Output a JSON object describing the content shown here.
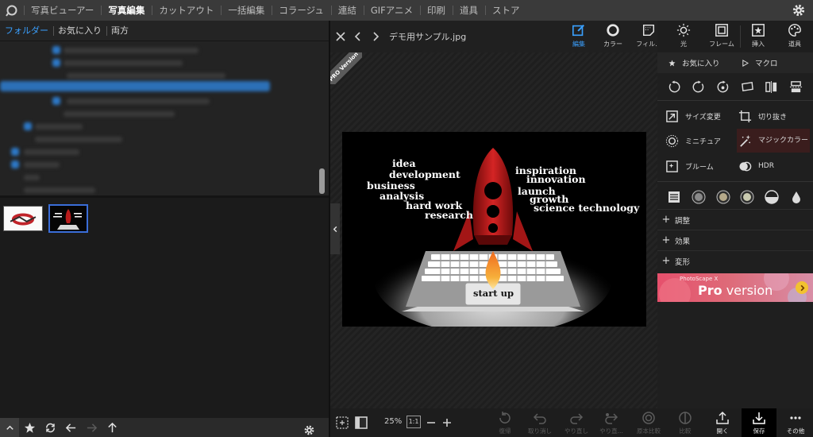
{
  "menu": {
    "items": [
      {
        "label": "写真ビューアー",
        "active": false
      },
      {
        "label": "写真編集",
        "active": true
      },
      {
        "label": "カットアウト",
        "active": false
      },
      {
        "label": "一括編集",
        "active": false
      },
      {
        "label": "コラージュ",
        "active": false
      },
      {
        "label": "連結",
        "active": false
      },
      {
        "label": "GIFアニメ",
        "active": false
      },
      {
        "label": "印刷",
        "active": false
      },
      {
        "label": "道具",
        "active": false
      },
      {
        "label": "ストア",
        "active": false
      }
    ]
  },
  "left_panel": {
    "tabs": [
      {
        "label": "フォルダー",
        "active": true
      },
      {
        "label": "お気に入り",
        "active": false
      },
      {
        "label": "両方",
        "active": false
      }
    ],
    "thumbnails": [
      "thumb-1",
      "thumb-2"
    ],
    "selected_thumbnail": 2
  },
  "editor": {
    "file_name": "デモ用サンプル.jpg",
    "ribbon": "PRO Version"
  },
  "photo_words": [
    "idea",
    "development",
    "business",
    "analysis",
    "hard work",
    "research",
    "inspiration",
    "innovation",
    "launch",
    "growth",
    "science technology"
  ],
  "photo_key_label": "start up",
  "tool_tabs": [
    {
      "label": "編集",
      "icon": "edit-icon",
      "active": true
    },
    {
      "label": "カラー",
      "icon": "color-ring-icon",
      "active": false
    },
    {
      "label": "フィル...",
      "icon": "filter-icon",
      "active": false
    },
    {
      "label": "光",
      "icon": "light-icon",
      "active": false
    },
    {
      "label": "フレーム",
      "icon": "frame-icon",
      "active": false
    },
    {
      "label": "挿入",
      "icon": "insert-icon",
      "active": false
    },
    {
      "label": "道具",
      "icon": "tools-icon",
      "active": false
    }
  ],
  "right_panel": {
    "favorites_label": "お気に入り",
    "macro_label": "マクロ",
    "tools": {
      "resize": "サイズ変更",
      "crop": "切り抜き",
      "miniature": "ミニチュア",
      "magic_color": "マジックカラー",
      "bloom": "ブルーム",
      "hdr": "HDR"
    },
    "sections": [
      "調整",
      "効果",
      "変形"
    ],
    "promo": {
      "small": "PhotoScape X",
      "pro": "Pro",
      "version": " version"
    }
  },
  "bottom_bar": {
    "zoom": "25%",
    "one_to_one": "1:1",
    "actions": [
      {
        "label": "復帰",
        "enabled": false
      },
      {
        "label": "取り消し",
        "enabled": false
      },
      {
        "label": "やり直し",
        "enabled": false
      },
      {
        "label": "やり直...",
        "enabled": false
      },
      {
        "label": "原本比較",
        "enabled": false
      },
      {
        "label": "比較",
        "enabled": false
      },
      {
        "label": "開く",
        "enabled": true
      },
      {
        "label": "保存",
        "enabled": true
      },
      {
        "label": "その他",
        "enabled": true
      }
    ]
  },
  "colors": {
    "accent": "#3aa0ff",
    "menu_bg": "#3a3a3a",
    "rocket": "#c81e1e",
    "flame": "#f2a030",
    "promo": "#e6506c"
  }
}
